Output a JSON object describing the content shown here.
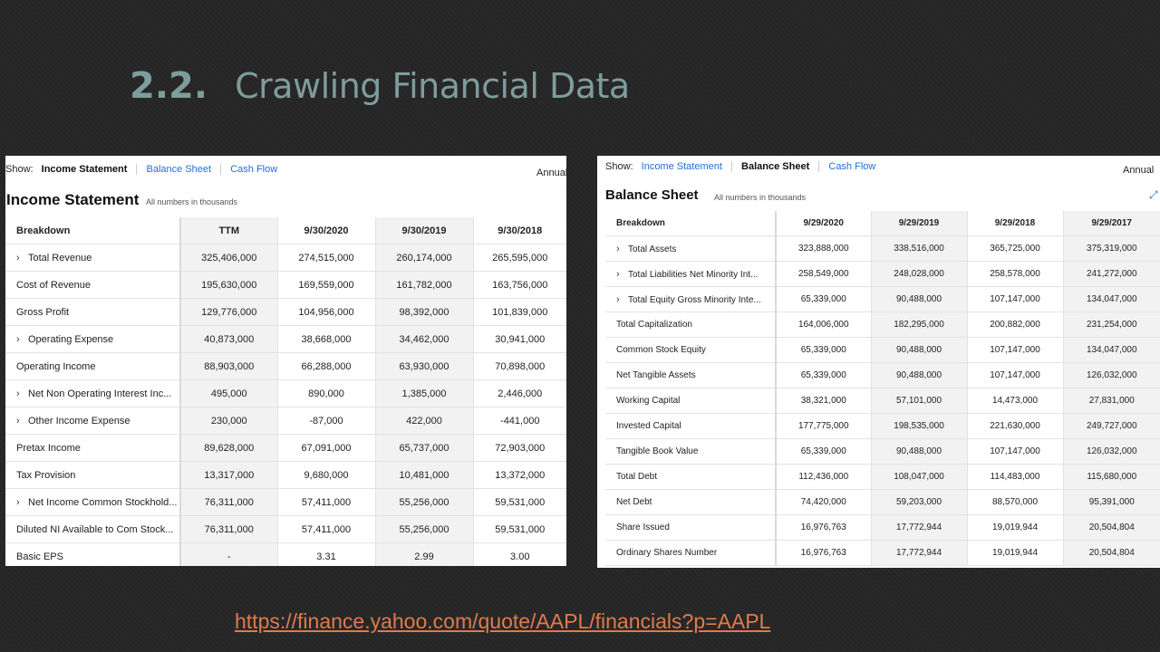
{
  "slide": {
    "number": "2.2.",
    "title": "Crawling Financial Data",
    "url": "https://finance.yahoo.com/quote/AAPL/financials?p=AAPL"
  },
  "income": {
    "show_label": "Show:",
    "tabs": [
      "Income Statement",
      "Balance Sheet",
      "Cash Flow"
    ],
    "active_tab": 0,
    "period": "Annual",
    "title": "Income Statement",
    "note": "All numbers in thousands",
    "headers": [
      "Breakdown",
      "TTM",
      "9/30/2020",
      "9/30/2019",
      "9/30/2018"
    ],
    "rows": [
      {
        "label": "Total Revenue",
        "expand": true,
        "values": [
          "325,406,000",
          "274,515,000",
          "260,174,000",
          "265,595,000"
        ]
      },
      {
        "label": "Cost of Revenue",
        "expand": false,
        "values": [
          "195,630,000",
          "169,559,000",
          "161,782,000",
          "163,756,000"
        ]
      },
      {
        "label": "Gross Profit",
        "expand": false,
        "values": [
          "129,776,000",
          "104,956,000",
          "98,392,000",
          "101,839,000"
        ]
      },
      {
        "label": "Operating Expense",
        "expand": true,
        "values": [
          "40,873,000",
          "38,668,000",
          "34,462,000",
          "30,941,000"
        ]
      },
      {
        "label": "Operating Income",
        "expand": false,
        "values": [
          "88,903,000",
          "66,288,000",
          "63,930,000",
          "70,898,000"
        ]
      },
      {
        "label": "Net Non Operating Interest Inc...",
        "expand": true,
        "values": [
          "495,000",
          "890,000",
          "1,385,000",
          "2,446,000"
        ]
      },
      {
        "label": "Other Income Expense",
        "expand": true,
        "values": [
          "230,000",
          "-87,000",
          "422,000",
          "-441,000"
        ]
      },
      {
        "label": "Pretax Income",
        "expand": false,
        "values": [
          "89,628,000",
          "67,091,000",
          "65,737,000",
          "72,903,000"
        ]
      },
      {
        "label": "Tax Provision",
        "expand": false,
        "values": [
          "13,317,000",
          "9,680,000",
          "10,481,000",
          "13,372,000"
        ]
      },
      {
        "label": "Net Income Common Stockhold...",
        "expand": true,
        "values": [
          "76,311,000",
          "57,411,000",
          "55,256,000",
          "59,531,000"
        ]
      },
      {
        "label": "Diluted NI Available to Com Stock...",
        "expand": false,
        "values": [
          "76,311,000",
          "57,411,000",
          "55,256,000",
          "59,531,000"
        ]
      },
      {
        "label": "Basic EPS",
        "expand": false,
        "values": [
          "-",
          "3.31",
          "2.99",
          "3.00"
        ]
      }
    ]
  },
  "balance": {
    "show_label": "Show:",
    "tabs": [
      "Income Statement",
      "Balance Sheet",
      "Cash Flow"
    ],
    "active_tab": 1,
    "period": "Annual",
    "title": "Balance Sheet",
    "note": "All numbers in thousands",
    "headers": [
      "Breakdown",
      "9/29/2020",
      "9/29/2019",
      "9/29/2018",
      "9/29/2017"
    ],
    "rows": [
      {
        "label": "Total Assets",
        "expand": true,
        "values": [
          "323,888,000",
          "338,516,000",
          "365,725,000",
          "375,319,000"
        ]
      },
      {
        "label": "Total Liabilities Net Minority Int...",
        "expand": true,
        "values": [
          "258,549,000",
          "248,028,000",
          "258,578,000",
          "241,272,000"
        ]
      },
      {
        "label": "Total Equity Gross Minority Inte...",
        "expand": true,
        "values": [
          "65,339,000",
          "90,488,000",
          "107,147,000",
          "134,047,000"
        ]
      },
      {
        "label": "Total Capitalization",
        "expand": false,
        "values": [
          "164,006,000",
          "182,295,000",
          "200,882,000",
          "231,254,000"
        ]
      },
      {
        "label": "Common Stock Equity",
        "expand": false,
        "values": [
          "65,339,000",
          "90,488,000",
          "107,147,000",
          "134,047,000"
        ]
      },
      {
        "label": "Net Tangible Assets",
        "expand": false,
        "values": [
          "65,339,000",
          "90,488,000",
          "107,147,000",
          "126,032,000"
        ]
      },
      {
        "label": "Working Capital",
        "expand": false,
        "values": [
          "38,321,000",
          "57,101,000",
          "14,473,000",
          "27,831,000"
        ]
      },
      {
        "label": "Invested Capital",
        "expand": false,
        "values": [
          "177,775,000",
          "198,535,000",
          "221,630,000",
          "249,727,000"
        ]
      },
      {
        "label": "Tangible Book Value",
        "expand": false,
        "values": [
          "65,339,000",
          "90,488,000",
          "107,147,000",
          "126,032,000"
        ]
      },
      {
        "label": "Total Debt",
        "expand": false,
        "values": [
          "112,436,000",
          "108,047,000",
          "114,483,000",
          "115,680,000"
        ]
      },
      {
        "label": "Net Debt",
        "expand": false,
        "values": [
          "74,420,000",
          "59,203,000",
          "88,570,000",
          "95,391,000"
        ]
      },
      {
        "label": "Share Issued",
        "expand": false,
        "values": [
          "16,976,763",
          "17,772,944",
          "19,019,944",
          "20,504,804"
        ]
      },
      {
        "label": "Ordinary Shares Number",
        "expand": false,
        "values": [
          "16,976,763",
          "17,772,944",
          "19,019,944",
          "20,504,804"
        ]
      }
    ]
  }
}
